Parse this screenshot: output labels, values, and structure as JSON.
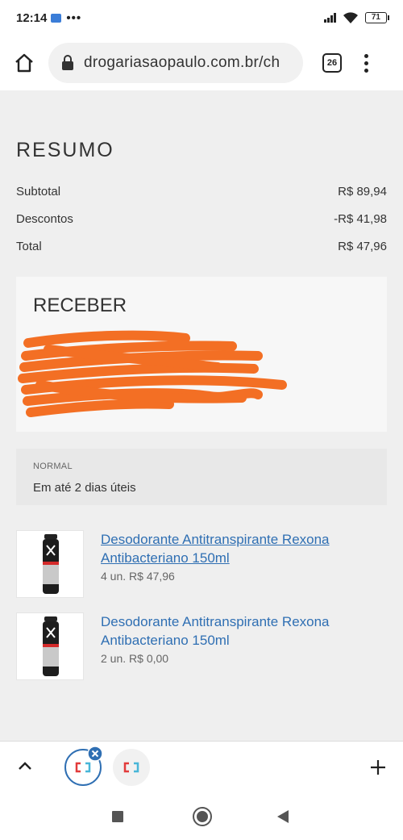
{
  "status_bar": {
    "time": "12:14",
    "dots": "•••",
    "battery": "71"
  },
  "browser": {
    "url": "drogariasaopaulo.com.br/ch",
    "tab_count": "26"
  },
  "summary": {
    "title": "RESUMO",
    "rows": [
      {
        "label": "Subtotal",
        "value": "R$ 89,94"
      },
      {
        "label": "Descontos",
        "value": "-R$ 41,98"
      },
      {
        "label": "Total",
        "value": "R$ 47,96"
      }
    ]
  },
  "receive": {
    "title": "RECEBER"
  },
  "shipping": {
    "type": "NORMAL",
    "eta": "Em até 2 dias úteis"
  },
  "products": [
    {
      "name": "Desodorante Antitranspirante Rexona Antibacteriano 150ml",
      "meta": "4 un. R$ 47,96"
    },
    {
      "name": "Desodorante Antitranspirante Rexona Antibacteriano 150ml",
      "meta": "2 un. R$ 0,00"
    }
  ],
  "colors": {
    "link": "#2f6fb3",
    "redaction": "#f36f24",
    "active_tab_ring": "#2f6fb3"
  },
  "icons": [
    "home-icon",
    "lock-icon",
    "more-vert-icon",
    "chevron-up-icon",
    "close-icon",
    "plus-icon",
    "recents-icon",
    "home-circle-icon",
    "back-icon"
  ]
}
